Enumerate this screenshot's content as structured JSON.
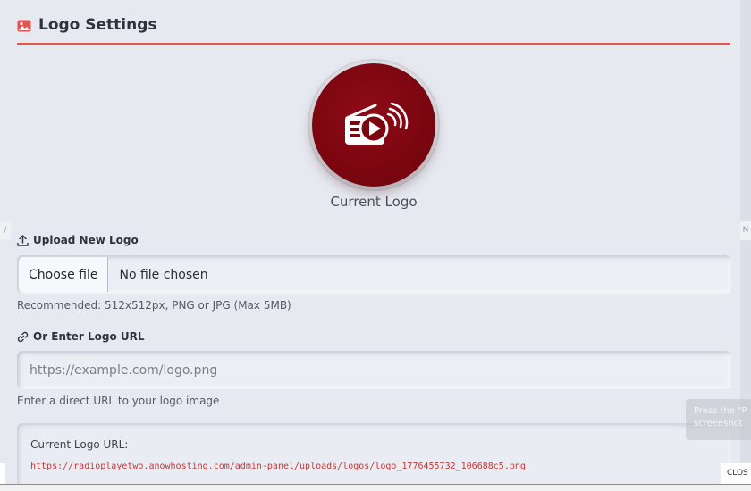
{
  "header": {
    "title": "Logo Settings",
    "icon": "image-icon",
    "accent": "#e0574f"
  },
  "logo": {
    "caption": "Current Logo",
    "icon": "radio-play-icon",
    "circle_color": "#7b0610"
  },
  "upload": {
    "label": "Upload New Logo",
    "icon": "upload-icon",
    "choose_label": "Choose file",
    "status": "No file chosen",
    "hint": "Recommended: 512x512px, PNG or JPG (Max 5MB)"
  },
  "url_entry": {
    "label": "Or Enter Logo URL",
    "icon": "link-icon",
    "placeholder": "https://example.com/logo.png",
    "value": "",
    "hint": "Enter a direct URL to your logo image"
  },
  "current_url": {
    "title": "Current Logo URL:",
    "value": "https://radioplayetwo.anowhosting.com/admin-panel/uploads/logos/logo_1776455732_106688c5.png",
    "color": "#c23a3a"
  },
  "overlay": {
    "toast_line1": "Press the \"P",
    "toast_line2": "screenshot",
    "close_label": "CLOS",
    "left_nav": "/",
    "right_nav": "N"
  }
}
